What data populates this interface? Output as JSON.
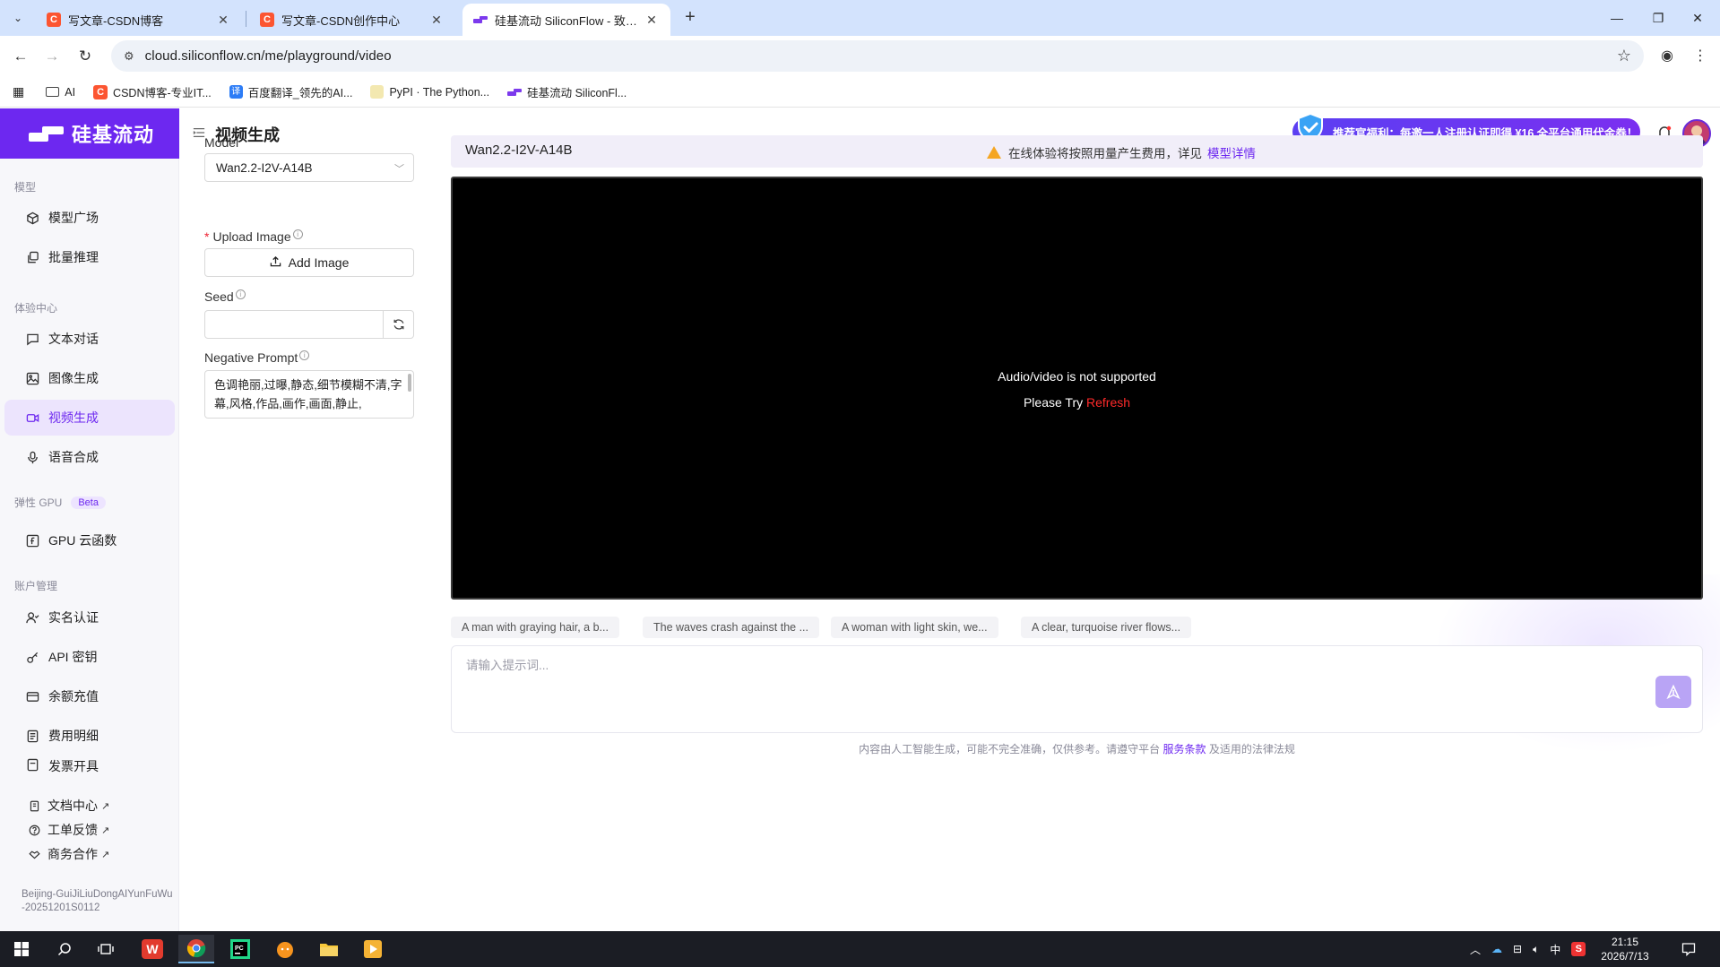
{
  "browser": {
    "tabs": [
      {
        "title": "写文章-CSDN博客",
        "favicon": "csdn-icon"
      },
      {
        "title": "写文章-CSDN创作中心",
        "favicon": "csdn-icon"
      },
      {
        "title": "硅基流动 SiliconFlow - 致力于",
        "favicon": "siliconflow-icon",
        "active": true
      }
    ],
    "url": "cloud.siliconflow.cn/me/playground/video",
    "bookmarks": [
      {
        "label": "AI",
        "icon": "folder-icon"
      },
      {
        "label": "CSDN博客-专业IT...",
        "icon": "csdn-icon"
      },
      {
        "label": "百度翻译_领先的AI...",
        "icon": "fanyi-icon"
      },
      {
        "label": "PyPI · The Python...",
        "icon": "pypi-icon"
      },
      {
        "label": "硅基流动 SiliconFl...",
        "icon": "siliconflow-icon"
      }
    ]
  },
  "app": {
    "logo_text": "硅基流动",
    "page_title": "视频生成",
    "promo_text": "推荐官福利：每邀一人注册认证即得 ¥16 全平台通用代金券！",
    "sidebar": {
      "section_model": "模型",
      "model_square": "模型广场",
      "batch_infer": "批量推理",
      "section_experience": "体验中心",
      "text_chat": "文本对话",
      "image_gen": "图像生成",
      "video_gen": "视频生成",
      "speech_synth": "语音合成",
      "section_gpu": "弹性 GPU",
      "beta": "Beta",
      "gpu_func": "GPU 云函数",
      "section_account": "账户管理",
      "real_name": "实名认证",
      "api_key": "API 密钥",
      "recharge": "余额充值",
      "billing": "费用明细",
      "invoice": "发票开具",
      "docs": "文档中心",
      "ticket": "工单反馈",
      "business": "商务合作",
      "version": "Beijing-GuiJiLiuDongAIYunFuWu-20251201S0112"
    },
    "params": {
      "model_label": "Model",
      "model_value": "Wan2.2-I2V-A14B",
      "upload_label": "Upload Image",
      "add_image": "Add Image",
      "seed_label": "Seed",
      "seed_value": "",
      "neg_label": "Negative Prompt",
      "neg_value": "色调艳丽,过曝,静态,细节模糊不清,字幕,风格,作品,画作,画面,静止,"
    },
    "main": {
      "model_name": "Wan2.2-I2V-A14B",
      "notice": "在线体验将按照用量产生费用，详见",
      "notice_link": "模型详情",
      "video_msg": "Audio/video is not supported",
      "video_try": "Please Try",
      "video_refresh": "Refresh",
      "chips": [
        "A man with graying hair, a b...",
        "The waves crash against the ...",
        "A woman with light skin, we...",
        "A clear, turquoise river flows..."
      ],
      "prompt_placeholder": "请输入提示词...",
      "footer_text": "内容由人工智能生成，可能不完全准确，仅供参考。请遵守平台",
      "footer_link": "服务条款",
      "footer_tail": "及适用的法律法规"
    }
  },
  "taskbar": {
    "time": "21:15",
    "date": "2026/7/13",
    "ime": "中"
  },
  "colors": {
    "brand": "#6d28f0",
    "active_bg": "#ece4fd",
    "warning": "#f5a623",
    "refresh_red": "#ff2a2a"
  }
}
